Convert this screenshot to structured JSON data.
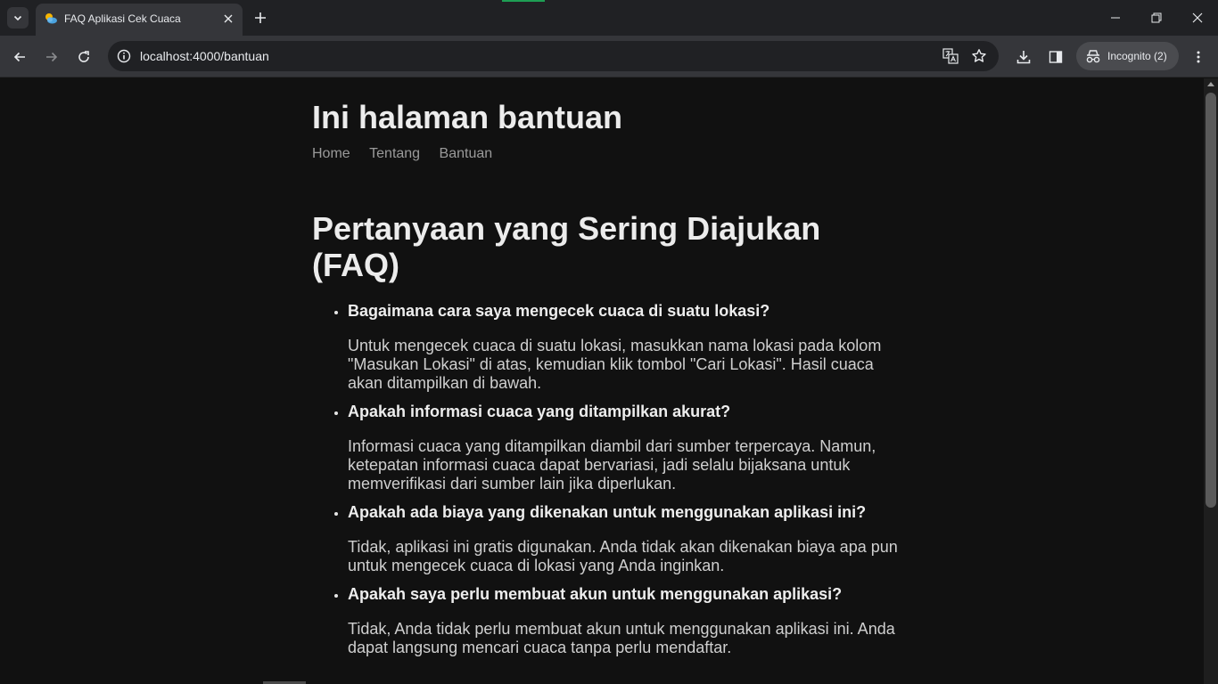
{
  "browser": {
    "tab_title": "FAQ Aplikasi Cek Cuaca",
    "url": "localhost:4000/bantuan",
    "incognito_label": "Incognito (2)"
  },
  "page": {
    "title": "Ini halaman bantuan",
    "nav": [
      "Home",
      "Tentang",
      "Bantuan"
    ],
    "faq_heading": "Pertanyaan yang Sering Diajukan (FAQ)",
    "faqs": [
      {
        "q": "Bagaimana cara saya mengecek cuaca di suatu lokasi?",
        "a": "Untuk mengecek cuaca di suatu lokasi, masukkan nama lokasi pada kolom \"Masukan Lokasi\" di atas, kemudian klik tombol \"Cari Lokasi\". Hasil cuaca akan ditampilkan di bawah."
      },
      {
        "q": "Apakah informasi cuaca yang ditampilkan akurat?",
        "a": "Informasi cuaca yang ditampilkan diambil dari sumber terpercaya. Namun, ketepatan informasi cuaca dapat bervariasi, jadi selalu bijaksana untuk memverifikasi dari sumber lain jika diperlukan."
      },
      {
        "q": "Apakah ada biaya yang dikenakan untuk menggunakan aplikasi ini?",
        "a": "Tidak, aplikasi ini gratis digunakan. Anda tidak akan dikenakan biaya apa pun untuk mengecek cuaca di lokasi yang Anda inginkan."
      },
      {
        "q": "Apakah saya perlu membuat akun untuk menggunakan aplikasi?",
        "a": "Tidak, Anda tidak perlu membuat akun untuk menggunakan aplikasi ini. Anda dapat langsung mencari cuaca tanpa perlu mendaftar."
      }
    ]
  },
  "colors": {
    "page_background": "#111111",
    "chrome_tabstrip": "#202124",
    "chrome_toolbar": "#35363a",
    "nav_link": "#9a9a9a"
  },
  "icons": {
    "tab_search": "chevron-down-icon",
    "favicon": "weather-favicon-icon",
    "close": "close-icon",
    "new_tab": "plus-icon",
    "back": "arrow-left-icon",
    "forward": "arrow-right-icon",
    "reload": "reload-icon",
    "site_info": "info-icon",
    "translate": "translate-icon",
    "bookmark": "star-icon",
    "download": "download-icon",
    "side_panel": "side-panel-icon",
    "incognito": "incognito-icon",
    "menu": "kebab-menu-icon"
  }
}
